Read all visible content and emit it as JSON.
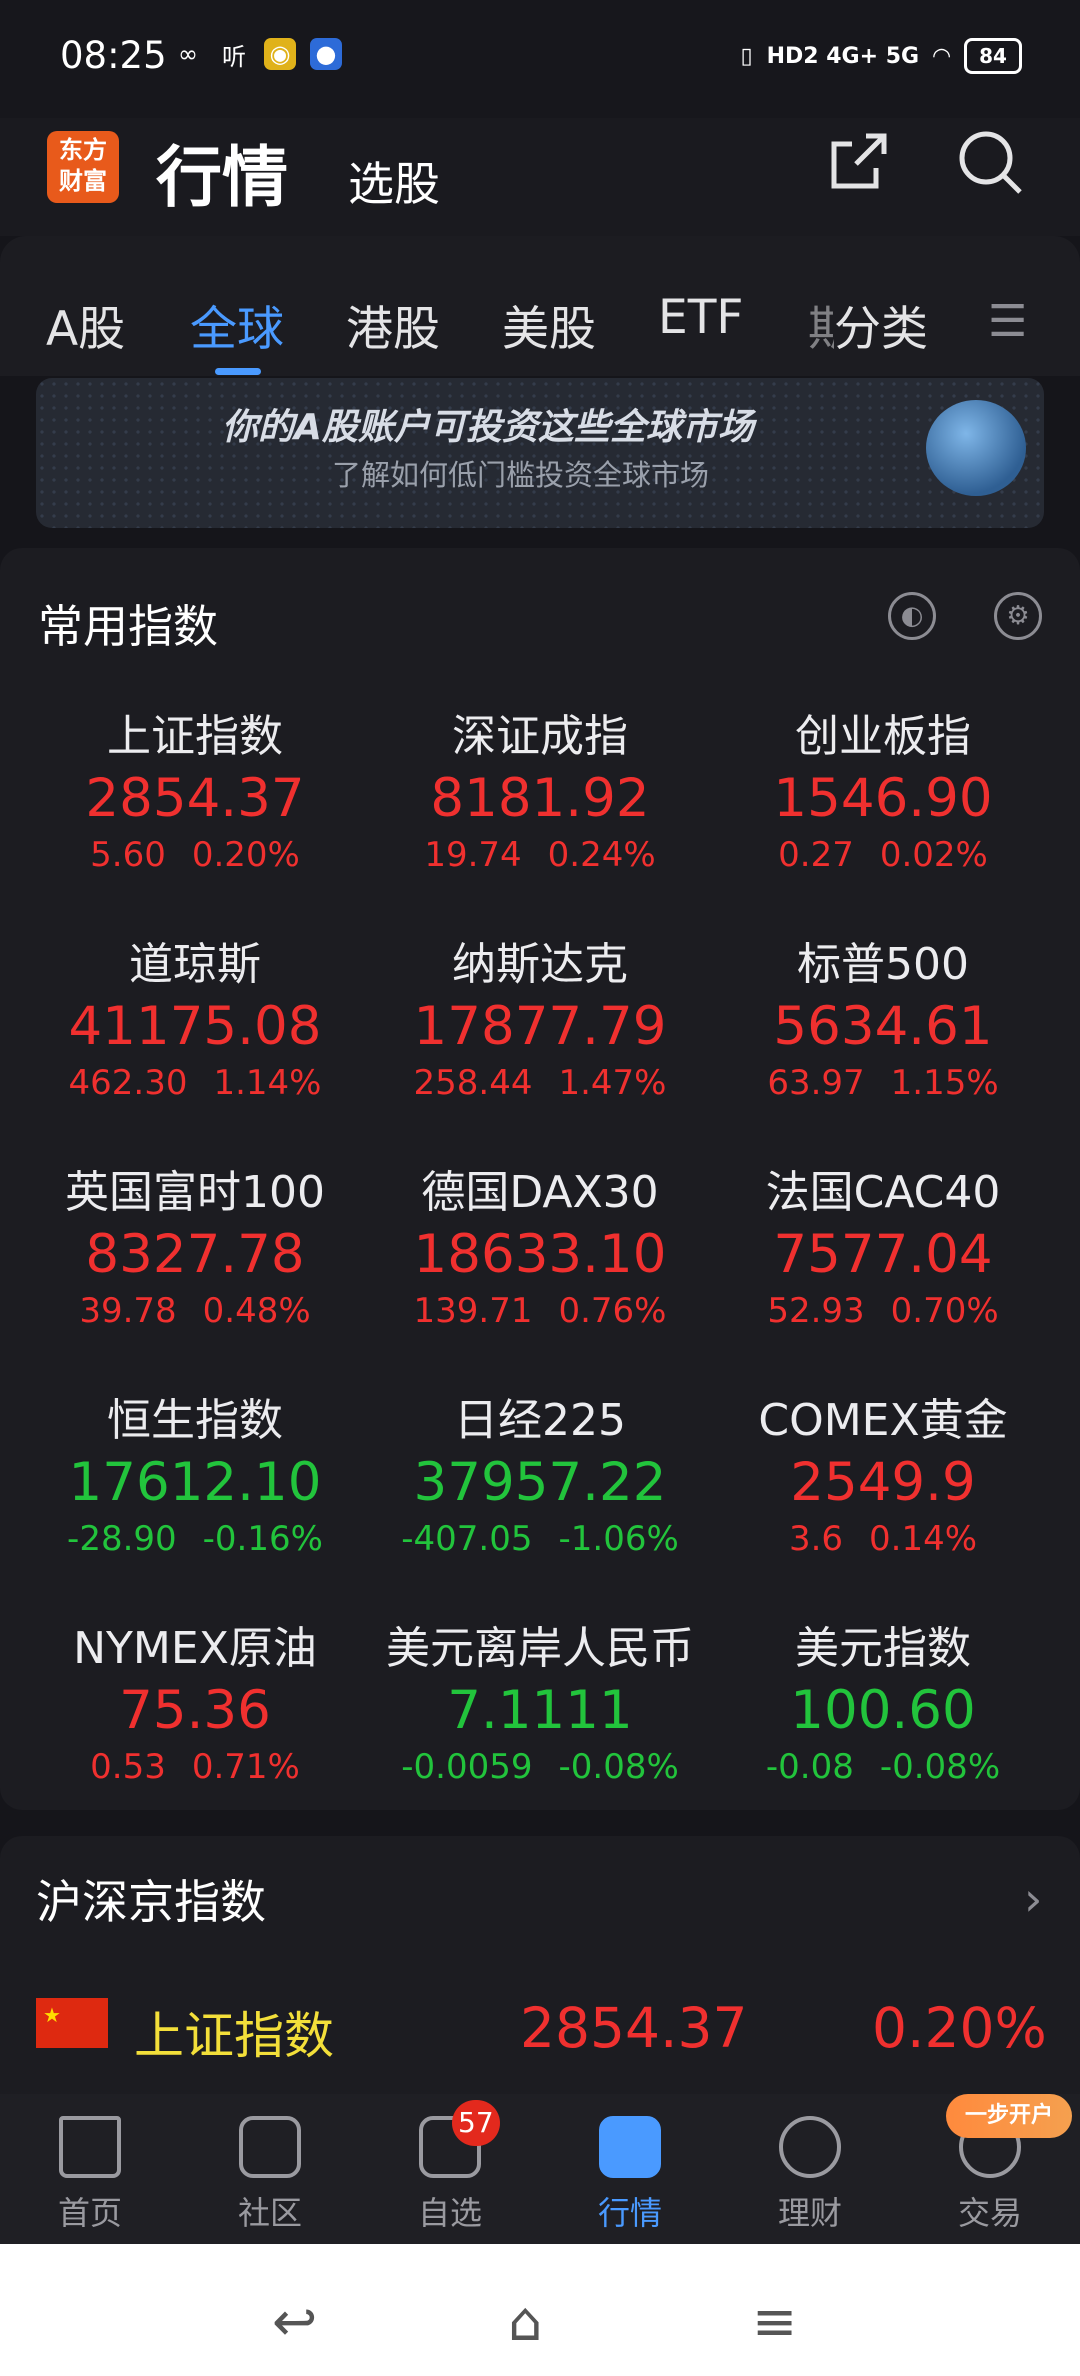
{
  "status_bar": {
    "time": "08:25",
    "left_icons": [
      "link-icon",
      "listen-app-icon",
      "weibo-icon",
      "app-icon"
    ],
    "network": "HD2 4G+ 5G",
    "battery": "84"
  },
  "header": {
    "logo_text_1": "东方",
    "logo_text_2": "财富",
    "title": "行情",
    "subtitle": "选股"
  },
  "tabs": [
    "A股",
    "全球",
    "港股",
    "美股",
    "ETF",
    "期",
    "分类"
  ],
  "active_tab": "全球",
  "banner": {
    "title": "你的A股账户可投资这些全球市场",
    "subtitle": "了解如何低门槛投资全球市场"
  },
  "common_indices": {
    "title": "常用指数",
    "items": [
      {
        "name": "上证指数",
        "price": "2854.37",
        "change": "5.60",
        "pct": "0.20%",
        "dir": "up"
      },
      {
        "name": "深证成指",
        "price": "8181.92",
        "change": "19.74",
        "pct": "0.24%",
        "dir": "up"
      },
      {
        "name": "创业板指",
        "price": "1546.90",
        "change": "0.27",
        "pct": "0.02%",
        "dir": "up"
      },
      {
        "name": "道琼斯",
        "price": "41175.08",
        "change": "462.30",
        "pct": "1.14%",
        "dir": "up"
      },
      {
        "name": "纳斯达克",
        "price": "17877.79",
        "change": "258.44",
        "pct": "1.47%",
        "dir": "up"
      },
      {
        "name": "标普500",
        "price": "5634.61",
        "change": "63.97",
        "pct": "1.15%",
        "dir": "up"
      },
      {
        "name": "英国富时100",
        "price": "8327.78",
        "change": "39.78",
        "pct": "0.48%",
        "dir": "up"
      },
      {
        "name": "德国DAX30",
        "price": "18633.10",
        "change": "139.71",
        "pct": "0.76%",
        "dir": "up"
      },
      {
        "name": "法国CAC40",
        "price": "7577.04",
        "change": "52.93",
        "pct": "0.70%",
        "dir": "up"
      },
      {
        "name": "恒生指数",
        "price": "17612.10",
        "change": "-28.90",
        "pct": "-0.16%",
        "dir": "down"
      },
      {
        "name": "日经225",
        "price": "37957.22",
        "change": "-407.05",
        "pct": "-1.06%",
        "dir": "down"
      },
      {
        "name": "COMEX黄金",
        "price": "2549.9",
        "change": "3.6",
        "pct": "0.14%",
        "dir": "up"
      },
      {
        "name": "NYMEX原油",
        "price": "75.36",
        "change": "0.53",
        "pct": "0.71%",
        "dir": "up"
      },
      {
        "name": "美元离岸人民币",
        "price": "7.1111",
        "change": "-0.0059",
        "pct": "-0.08%",
        "dir": "down"
      },
      {
        "name": "美元指数",
        "price": "100.60",
        "change": "-0.08",
        "pct": "-0.08%",
        "dir": "down"
      }
    ]
  },
  "hsj_section": {
    "title": "沪深京指数",
    "row": {
      "name": "上证指数",
      "price": "2854.37",
      "pct": "0.20%"
    }
  },
  "bottom_nav": {
    "items": [
      "首页",
      "社区",
      "自选",
      "行情",
      "理财",
      "交易"
    ],
    "active": "行情",
    "watchlist_badge": "57",
    "promo": "一步开户"
  },
  "colors": {
    "up": "#f0302f",
    "down": "#22c43c",
    "accent": "#4a9aff",
    "brand": "#e85a1b"
  }
}
